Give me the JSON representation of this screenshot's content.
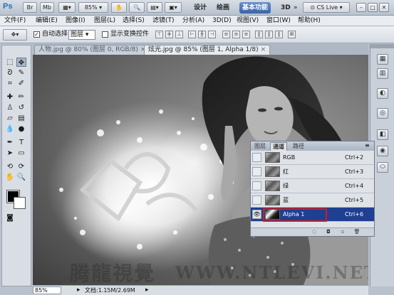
{
  "app": {
    "logo": "Ps",
    "zoom": "85%",
    "workspaces": [
      "设计",
      "绘画",
      "基本功能",
      "3D"
    ],
    "cslive": "CS Live",
    "window_buttons": [
      "–",
      "□",
      "✕"
    ]
  },
  "menu": [
    "文件(F)",
    "编辑(E)",
    "图像(I)",
    "图层(L)",
    "选择(S)",
    "滤镜(T)",
    "分析(A)",
    "3D(D)",
    "视图(V)",
    "窗口(W)",
    "帮助(H)"
  ],
  "options": {
    "auto_select_label": "自动选择:",
    "auto_select_value": "图层",
    "show_transform_label": "显示变换控件"
  },
  "tabs": [
    {
      "label": "人物.jpg @ 80% (图层 0, RGB/8)"
    },
    {
      "label": "炫光.jpg @ 85% (图层 1, Alpha 1/8)"
    }
  ],
  "tab_close": "×",
  "canvas": {
    "watermark_1": "腾龍視覺",
    "watermark_2": "WWW.NTLEVI.NET"
  },
  "status": {
    "zoom": "85%",
    "doc_info": "文档:1.15M/2.69M"
  },
  "channels_panel": {
    "tabs": [
      "图层",
      "通道",
      "路径"
    ],
    "rows": [
      {
        "name": "RGB",
        "shortcut": "Ctrl+2"
      },
      {
        "name": "红",
        "shortcut": "Ctrl+3"
      },
      {
        "name": "绿",
        "shortcut": "Ctrl+4"
      },
      {
        "name": "蓝",
        "shortcut": "Ctrl+5"
      },
      {
        "name": "Alpha 1",
        "shortcut": "Ctrl+6"
      }
    ]
  },
  "colors": {
    "accent_highlight": "#d21c1c",
    "selected_row": "#1f3f92"
  }
}
